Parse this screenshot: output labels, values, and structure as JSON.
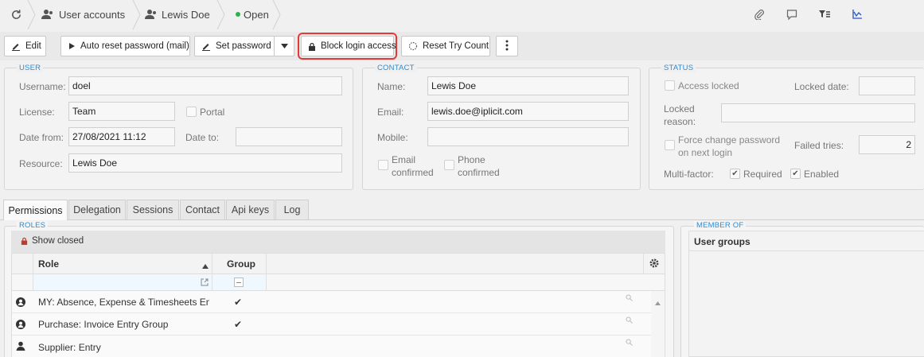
{
  "breadcrumb": {
    "items": [
      {
        "label": "User accounts",
        "icon": "users-icon"
      },
      {
        "label": "Lewis Doe",
        "icon": "user-icon"
      },
      {
        "label": "Open",
        "icon": "status-dot"
      }
    ],
    "status_color": "#2bb24c"
  },
  "top_actions": [
    "paperclip-icon",
    "comment-icon",
    "filter-list-icon",
    "chart-icon"
  ],
  "toolbar": {
    "edit": "Edit",
    "auto_reset": "Auto reset password (mail)",
    "set_password": "Set password",
    "block_login": "Block login access",
    "reset_try_count": "Reset Try Count"
  },
  "user": {
    "section": "USER",
    "username_label": "Username:",
    "username": "doel",
    "license_label": "License:",
    "license": "Team",
    "portal_label": "Portal",
    "date_from_label": "Date from:",
    "date_from": "27/08/2021 11:12",
    "date_to_label": "Date to:",
    "date_to": "",
    "resource_label": "Resource:",
    "resource": "Lewis Doe"
  },
  "contact": {
    "section": "CONTACT",
    "name_label": "Name:",
    "name": "Lewis Doe",
    "email_label": "Email:",
    "email": "lewis.doe@iplicit.com",
    "mobile_label": "Mobile:",
    "mobile": "",
    "email_confirmed_1": "Email",
    "email_confirmed_2": "confirmed",
    "phone_confirmed_1": "Phone",
    "phone_confirmed_2": "confirmed"
  },
  "status": {
    "section": "STATUS",
    "access_locked_label": "Access locked",
    "locked_date_label": "Locked date:",
    "locked_date": "",
    "locked_reason_label_1": "Locked",
    "locked_reason_label_2": "reason:",
    "locked_reason": "",
    "force_change_1": "Force change password",
    "force_change_2": "on next login",
    "failed_tries_label": "Failed tries:",
    "failed_tries": "2",
    "multifactor_label": "Multi-factor:",
    "required_label": "Required",
    "enabled_label": "Enabled"
  },
  "tabs": [
    "Permissions",
    "Delegation",
    "Sessions",
    "Contact",
    "Api keys",
    "Log"
  ],
  "roles": {
    "section": "ROLES",
    "show_closed": "Show closed",
    "col_role": "Role",
    "col_group": "Group",
    "rows": [
      {
        "role": "MY: Absence, Expense & Timesheets En...",
        "group": "✔",
        "icon": "group-user-icon"
      },
      {
        "role": "Purchase: Invoice Entry Group",
        "group": "✔",
        "icon": "group-user-icon"
      },
      {
        "role": "Supplier: Entry",
        "group": "",
        "icon": "single-user-icon"
      }
    ]
  },
  "member_of": {
    "section": "MEMBER OF",
    "header": "User groups"
  }
}
